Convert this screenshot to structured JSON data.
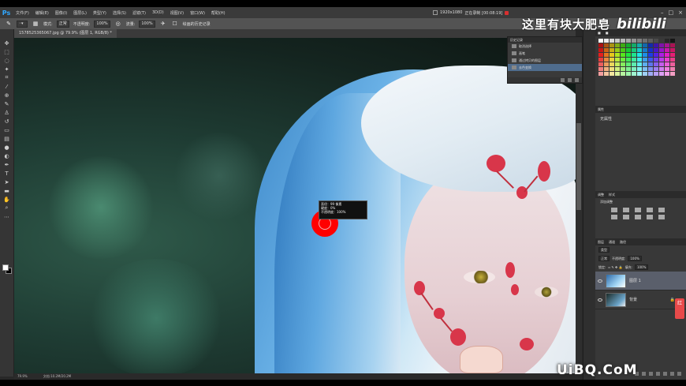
{
  "app": {
    "logo": "Ps"
  },
  "menu": [
    "文件(F)",
    "编辑(E)",
    "图像(I)",
    "图层(L)",
    "类型(Y)",
    "选择(S)",
    "滤镜(T)",
    "3D(D)",
    "视图(V)",
    "窗口(W)",
    "帮助(H)"
  ],
  "window_info": {
    "resolution": "1920x1080",
    "rec_text": "正在录制 [00:08:19]"
  },
  "options": {
    "mode_label": "模式:",
    "mode_value": "正常",
    "opacity_label": "不透明度:",
    "opacity_value": "100%",
    "flow_label": "流量:",
    "flow_value": "100%",
    "history_label": "绘画的历史记录"
  },
  "watermark": {
    "text": "这里有块大肥皂",
    "logo": "bilibili"
  },
  "document": {
    "tab_title": "1578525365067.jpg @ 79.9% (图层 1, RGB/8) *"
  },
  "brush_tooltip": {
    "line1": "直径：99 像素",
    "line2": "硬度：0%",
    "line3": "不透明度：100%"
  },
  "history_panel": {
    "title": "历史记录",
    "items": [
      {
        "label": "取消选择"
      },
      {
        "label": "画笔"
      },
      {
        "label": "通过拷贝的图层"
      },
      {
        "label": "去色变换"
      }
    ]
  },
  "status": {
    "zoom": "79.9%",
    "doc": "文档:10.2M/20.2M"
  },
  "props_panel": {
    "tabs": [
      "属性"
    ],
    "body": "无属性"
  },
  "adjust_panel": {
    "tabs": [
      "调整",
      "样式"
    ],
    "title": "添加调整"
  },
  "layers_panel": {
    "tabs": [
      "图层",
      "通道",
      "路径"
    ],
    "kind_label": "类型",
    "blend_value": "正常",
    "opacity_label": "不透明度:",
    "opacity_value": "100%",
    "lock_label": "锁定:",
    "fill_label": "填充:",
    "fill_value": "100%",
    "layers": [
      {
        "name": "图层 1",
        "selected": true
      },
      {
        "name": "背景",
        "selected": false
      }
    ]
  },
  "side_badge": "红",
  "site_watermark": "UiBQ.CoM",
  "colors": {
    "accent_ps": "#31a8ff",
    "brush_red": "#ff0000",
    "badge_red": "#e84a4a"
  }
}
